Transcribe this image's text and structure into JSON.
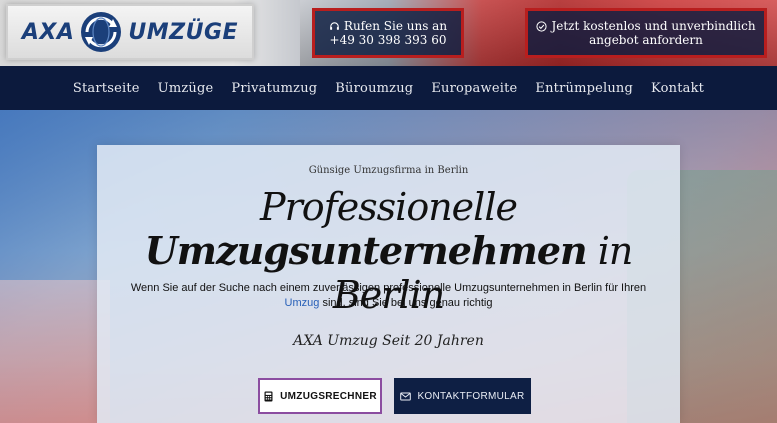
{
  "header": {
    "logo": {
      "left_text": "AXA",
      "right_text": "UMZÜGE",
      "icon": "globe-arrows-icon"
    },
    "phone_cta": {
      "label": "Rufen Sie uns an",
      "number": "+49 30 398 393 60",
      "icon": "headset-icon"
    },
    "offer_cta": {
      "line1": "Jetzt kostenlos und unverbindlich",
      "line2": "angebot anfordern",
      "icon": "check-badge-icon"
    }
  },
  "nav": {
    "items": [
      {
        "label": "Startseite"
      },
      {
        "label": "Umzüge"
      },
      {
        "label": "Privatumzug"
      },
      {
        "label": "Büroumzug"
      },
      {
        "label": "Europaweite"
      },
      {
        "label": "Entrümpelung"
      },
      {
        "label": "Kontakt"
      }
    ]
  },
  "hero": {
    "eyebrow": "Günsige Umzugsfirma in Berlin",
    "headline_part1": "Professionelle ",
    "headline_bold": "Umzugsunternehmen",
    "headline_part2": " in Berlin",
    "lead_before": "Wenn Sie auf der Suche nach einem zuverlässigen professionelle Umzugsunternehmen in Berlin für Ihren ",
    "lead_link": "Umzug",
    "lead_after": " sind, sind Sie bei uns genau richtig",
    "since": "AXA Umzug Seit 20 Jahren",
    "buttons": {
      "calculator": {
        "label": "UMZUGSRECHNER",
        "icon": "calculator-icon"
      },
      "contact": {
        "label": "KONTAKTFORMULAR",
        "icon": "envelope-icon"
      }
    }
  },
  "colors": {
    "navy": "#0c1a3d",
    "accent_red": "#b81e1e",
    "logo_blue": "#1b3f7a",
    "link_blue": "#2860b8",
    "button_border_purple": "#8b4da0"
  }
}
